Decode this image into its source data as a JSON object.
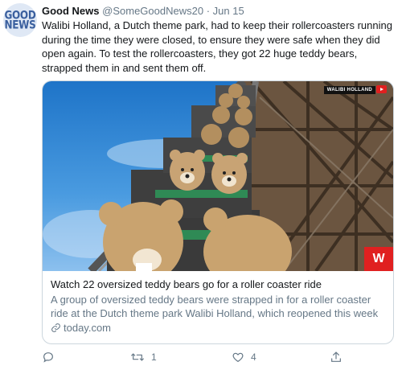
{
  "account": {
    "avatar_line1": "GOOD",
    "avatar_line2": "NEWS",
    "display_name": "Good News",
    "handle": "@SomeGoodNews20",
    "separator": "·",
    "date": "Jun 15"
  },
  "tweet": {
    "text": "Walibi Holland, a Dutch theme park, had to keep their rollercoasters running during the time they were closed, to ensure they were safe when they did open again. To test the rollercoasters, they got 22 huge teddy bears, strapped them in and sent them off."
  },
  "card": {
    "watermark": "WALIBI HOLLAND",
    "corner_logo": "W",
    "title": "Watch 22 oversized teddy bears go for a roller coaster ride",
    "description": "A group of oversized teddy bears were strapped in for a roller coaster ride at the Dutch theme park Walibi Holland, which reopened this week",
    "domain": "today.com"
  },
  "actions": {
    "reply_count": "",
    "retweet_count": "1",
    "like_count": "4",
    "icons": [
      "reply-icon",
      "retweet-icon",
      "like-icon",
      "share-icon"
    ]
  },
  "colors": {
    "text": "#14171a",
    "muted": "#657786",
    "border": "#ccd6dd"
  }
}
